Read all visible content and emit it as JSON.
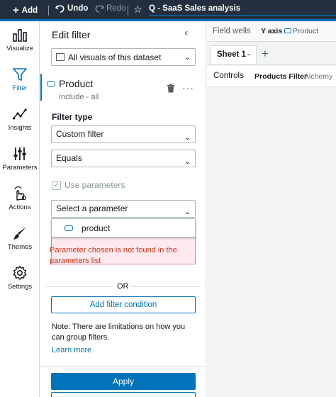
{
  "topbar": {
    "add_label": "Add",
    "undo_label": "Undo",
    "redo_label": "Redo",
    "analysis_title": "Q - SaaS Sales analysis"
  },
  "rail": {
    "items": [
      {
        "label": "Visualize",
        "icon": "bar-chart-icon"
      },
      {
        "label": "Filter",
        "icon": "filter-icon"
      },
      {
        "label": "Insights",
        "icon": "insights-icon"
      },
      {
        "label": "Parameters",
        "icon": "parameters-icon"
      },
      {
        "label": "Actions",
        "icon": "actions-icon"
      },
      {
        "label": "Themes",
        "icon": "brush-icon"
      },
      {
        "label": "Settings",
        "icon": "gear-icon"
      }
    ],
    "active": "Filter"
  },
  "panel": {
    "title": "Edit filter",
    "scope_value": "All visuals of this dataset",
    "field_name": "Product",
    "field_subtitle": "Include - all",
    "filter_type_label": "Filter type",
    "filter_type_value": "Custom filter",
    "operator_value": "Equals",
    "use_parameters_label": "Use parameters",
    "use_parameters_checked": true,
    "parameter_placeholder": "Select a parameter",
    "parameter_options": [
      "product"
    ],
    "error_text": "Parameter chosen is not found in the parameters list",
    "or_label": "OR",
    "add_condition_label": "Add filter condition",
    "note_text": "Note: There are limitations on how you can group filters.",
    "learn_more_label": "Learn more",
    "apply_label": "Apply"
  },
  "right": {
    "field_wells_label": "Field wells",
    "y_axis_label": "Y axis",
    "y_axis_value": "Product",
    "sheet_tab_label": "Sheet 1",
    "controls_label": "Controls",
    "products_filter_label": "Products Filter",
    "products_filter_value": "Alchemy"
  },
  "colors": {
    "accent": "#0073bb",
    "topbar_bg": "#232f3e",
    "error": "#d13212",
    "error_bg": "#fde9ee"
  }
}
